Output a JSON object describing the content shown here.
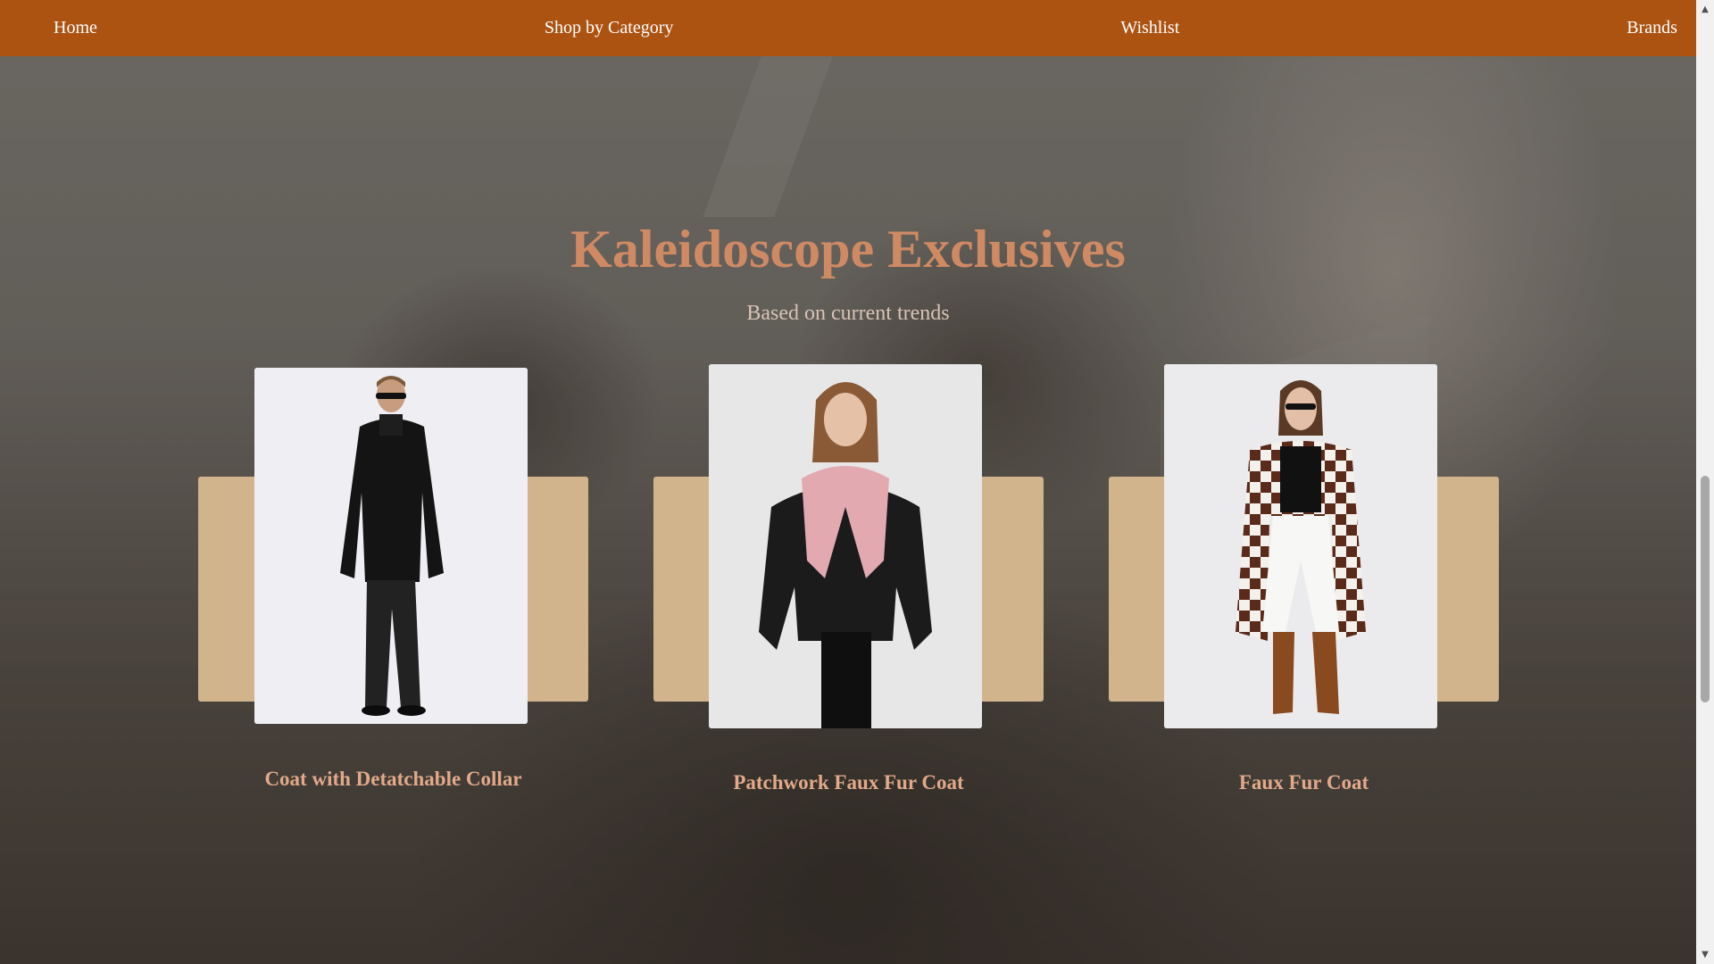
{
  "nav": {
    "items": [
      {
        "label": "Home"
      },
      {
        "label": "Shop by Category"
      },
      {
        "label": "Wishlist"
      },
      {
        "label": "Brands"
      }
    ]
  },
  "section": {
    "title": "Kaleidoscope Exclusives",
    "subtitle": "Based on current trends"
  },
  "products": [
    {
      "title": "Coat with Detatchable Collar",
      "image": "man-in-black-coat-photo"
    },
    {
      "title": "Patchwork Faux Fur Coat",
      "image": "woman-in-leather-pink-fur-jacket-photo"
    },
    {
      "title": "Faux Fur Coat",
      "image": "woman-in-checkered-fur-coat-photo"
    }
  ],
  "colors": {
    "nav_bg": "#ad5312",
    "title": "#cf8a64",
    "card_backdrop": "#d2b48c",
    "card_title": "#e1a98a"
  },
  "scrollbar": {
    "up_icon": "triangle-up-icon",
    "down_icon": "triangle-down-icon"
  }
}
